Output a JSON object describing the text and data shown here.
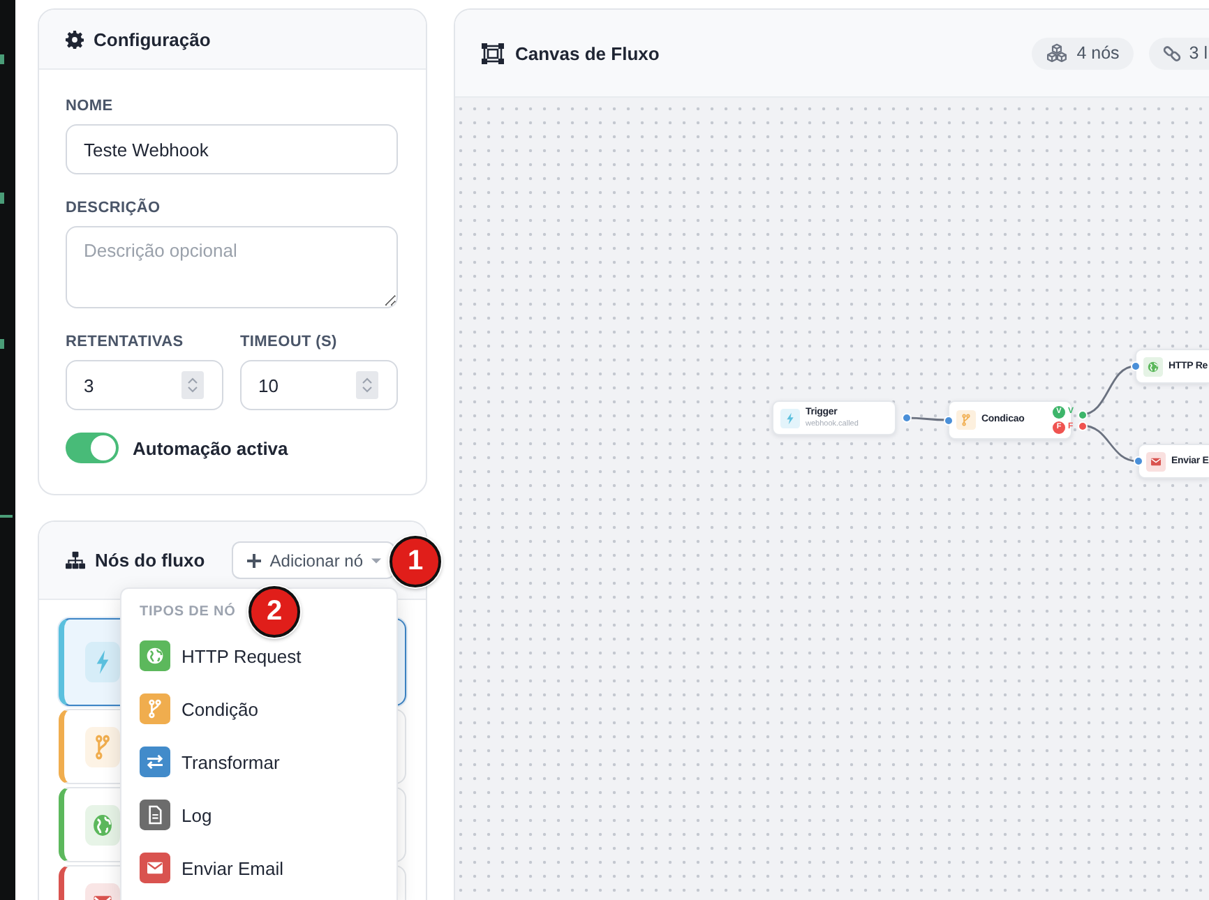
{
  "config": {
    "title": "Configuração",
    "name_field": {
      "label": "NOME",
      "value": "Teste Webhook"
    },
    "description_field": {
      "label": "DESCRIÇÃO",
      "placeholder": "Descrição opcional"
    },
    "number_fields": [
      {
        "label": "RETENTATIVAS",
        "value": "3"
      },
      {
        "label": "TIMEOUT (S)",
        "value": "10"
      }
    ],
    "toggle": {
      "label": "Automação activa",
      "on": true
    }
  },
  "nodes_panel": {
    "title": "Nós do fluxo",
    "add_button": "Adicionar nó",
    "items": [
      {
        "kind": "trigger",
        "color": "#5bc0de",
        "selected": true
      },
      {
        "kind": "condition",
        "color": "#f0ad4e",
        "selected": false
      },
      {
        "kind": "http",
        "color": "#5cb85c",
        "selected": false
      },
      {
        "kind": "email",
        "color": "#d9534f",
        "selected": false
      }
    ],
    "menu": {
      "heading": "TIPOS DE NÓ",
      "items": [
        {
          "kind": "http",
          "label": "HTTP Request",
          "color": "#5cb85c"
        },
        {
          "kind": "condition",
          "label": "Condição",
          "color": "#f0ad4e"
        },
        {
          "kind": "transform",
          "label": "Transformar",
          "color": "#428bca"
        },
        {
          "kind": "log",
          "label": "Log",
          "color": "#6c6c6c"
        },
        {
          "kind": "email",
          "label": "Enviar Email",
          "color": "#d9534f"
        }
      ]
    }
  },
  "canvas": {
    "title": "Canvas de Fluxo",
    "stats": [
      {
        "kind": "nodes",
        "text": "4 nós"
      },
      {
        "kind": "links",
        "text": "3 l"
      }
    ],
    "flow": [
      {
        "kind": "trigger",
        "title": "Trigger",
        "subtitle": "webhook.called",
        "children": [
          {
            "kind": "condition",
            "title": "Condicao",
            "outputs": [
              {
                "badge": "V",
                "label": "V",
                "color": "#3db56a",
                "children": [
                  {
                    "kind": "http",
                    "title": "HTTP Re"
                  }
                ]
              },
              {
                "badge": "F",
                "label": "F",
                "color": "#ef5350",
                "children": [
                  {
                    "kind": "email",
                    "title": "Enviar E"
                  }
                ]
              }
            ]
          }
        ]
      }
    ]
  },
  "callouts": [
    {
      "text": "1"
    },
    {
      "text": "2"
    }
  ]
}
